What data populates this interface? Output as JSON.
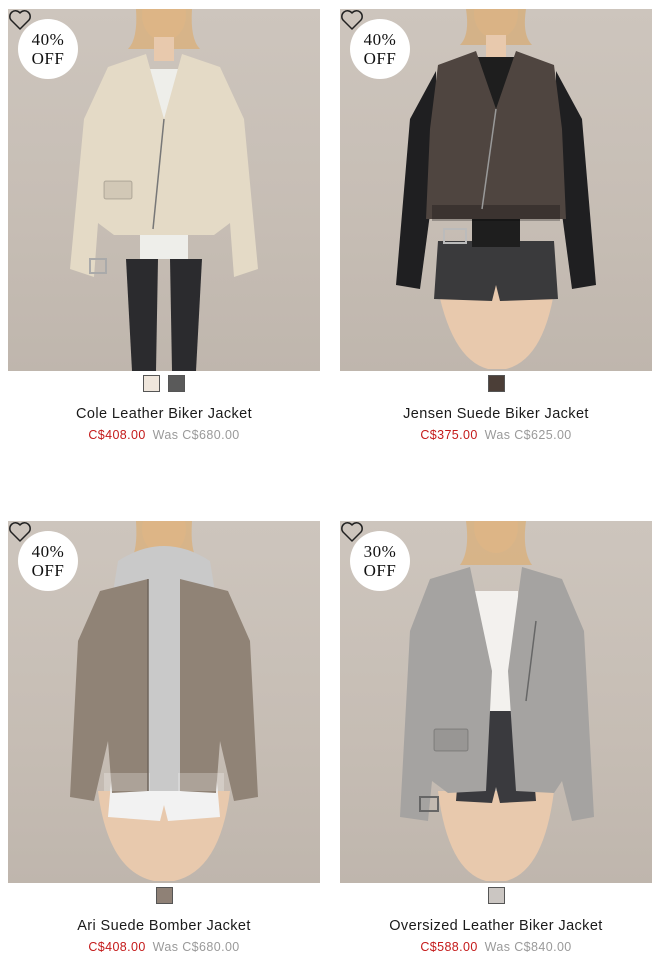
{
  "products": [
    {
      "name": "Cole Leather Biker Jacket",
      "sale_price": "C$408.00",
      "was_label": "Was",
      "was_price": "C$680.00",
      "discount_line1": "40%",
      "discount_line2": "OFF",
      "jacket_color": "#e4dac6",
      "top_color": "#eeeeea",
      "bottom_color": "#2b2b2e",
      "swatches": [
        "#efe6dc",
        "#5a5a5a"
      ]
    },
    {
      "name": "Jensen Suede Biker Jacket",
      "sale_price": "C$375.00",
      "was_label": "Was",
      "was_price": "C$625.00",
      "discount_line1": "40%",
      "discount_line2": "OFF",
      "jacket_color": "#4f4540",
      "top_color": "#1e1e1e",
      "bottom_color": "#3a3a3c",
      "swatches": [
        "#4b3e37"
      ]
    },
    {
      "name": "Ari Suede Bomber Jacket",
      "sale_price": "C$408.00",
      "was_label": "Was",
      "was_price": "C$680.00",
      "discount_line1": "40%",
      "discount_line2": "OFF",
      "jacket_color": "#908376",
      "top_color": "#c9c9c9",
      "bottom_color": "#f2f2f2",
      "swatches": [
        "#8f8176"
      ]
    },
    {
      "name": "Oversized Leather Biker Jacket",
      "sale_price": "C$588.00",
      "was_label": "Was",
      "was_price": "C$840.00",
      "discount_line1": "30%",
      "discount_line2": "OFF",
      "jacket_color": "#a5a3a1",
      "top_color": "#f3f1ee",
      "bottom_color": "#3a3a3e",
      "swatches": [
        "#cbc6c2"
      ]
    }
  ]
}
